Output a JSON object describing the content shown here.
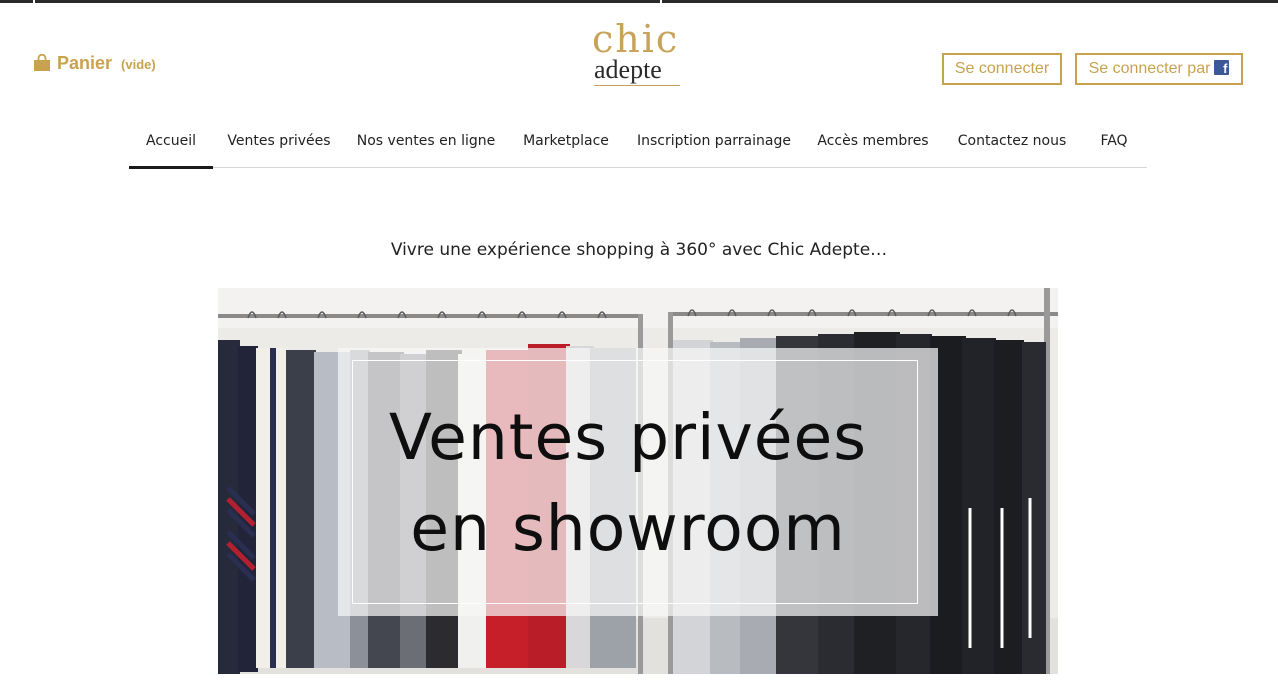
{
  "cart": {
    "label": "Panier",
    "status": "(vide)",
    "icon": "shopping-bag-icon"
  },
  "logo": {
    "top": "chic",
    "bottom": "adepte"
  },
  "auth": {
    "login_label": "Se connecter",
    "facebook_label": "Se connecter par",
    "facebook_icon": "facebook-icon"
  },
  "nav": {
    "items": [
      {
        "label": "Accueil"
      },
      {
        "label": "Ventes privées"
      },
      {
        "label": "Nos ventes en ligne"
      },
      {
        "label": "Marketplace"
      },
      {
        "label": "Inscription parrainage"
      },
      {
        "label": "Accès membres"
      },
      {
        "label": "Contactez nous"
      },
      {
        "label": "FAQ"
      }
    ]
  },
  "tagline": "Vivre une expérience shopping à 360° avec Chic Adepte…",
  "hero": {
    "line1": "Ventes privées",
    "line2": "en showroom"
  },
  "colors": {
    "accent": "#c9a24f",
    "text": "#222222",
    "facebook": "#3b5998"
  }
}
